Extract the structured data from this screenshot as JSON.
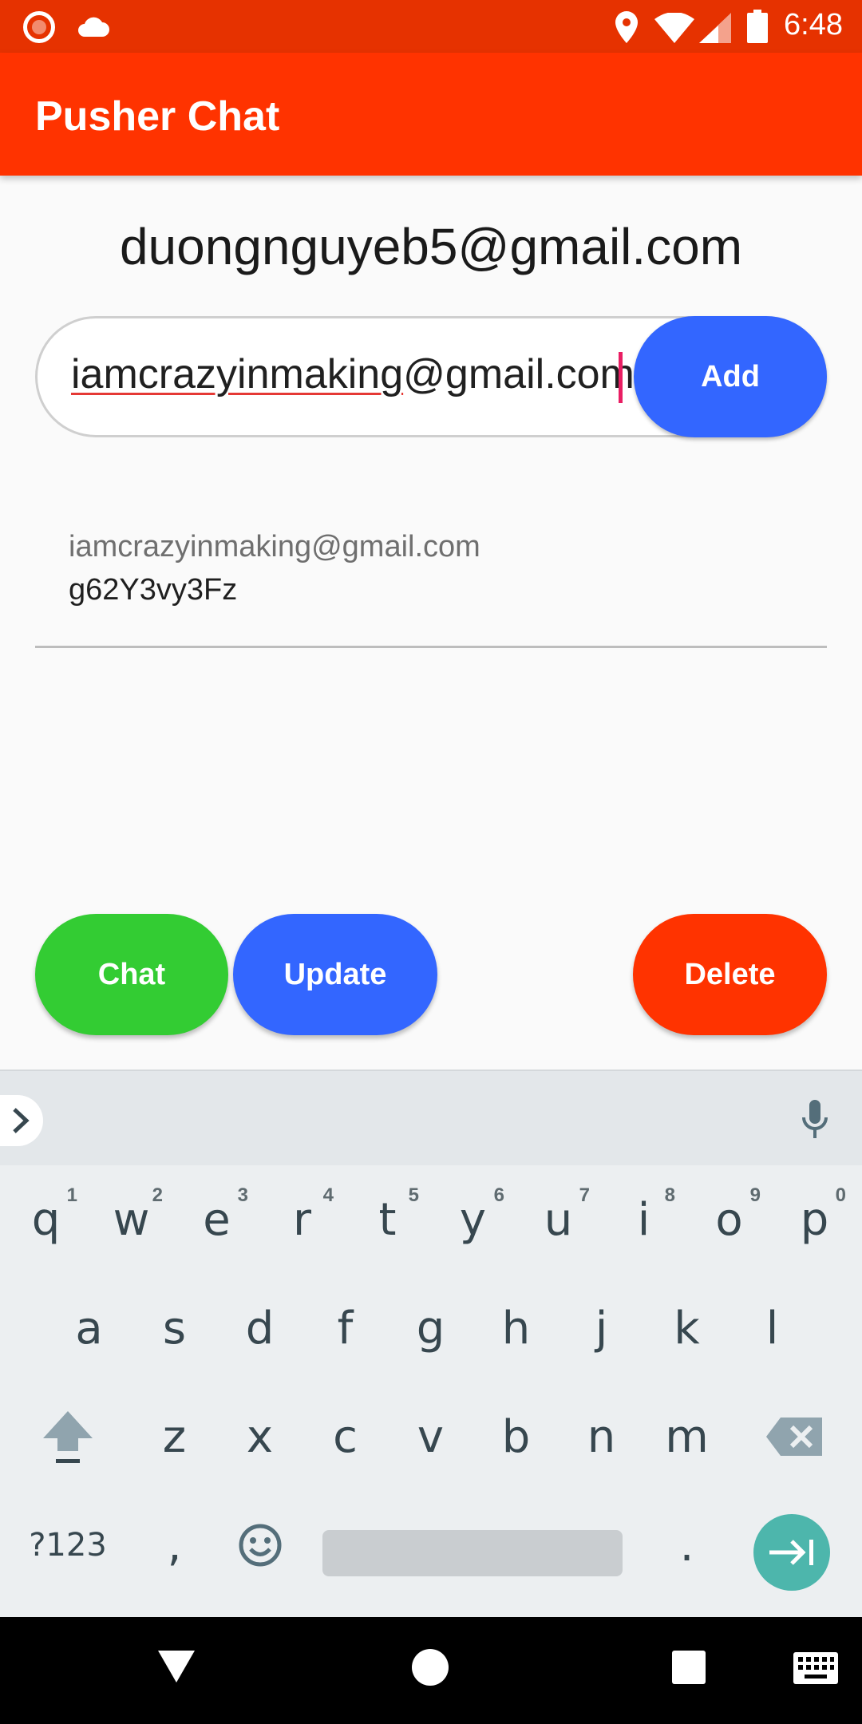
{
  "status_bar": {
    "time": "6:48",
    "icons": [
      "screen-record-icon",
      "cloud-icon",
      "location-pin-icon",
      "wifi-icon",
      "cell-signal-icon",
      "battery-icon"
    ]
  },
  "app_bar": {
    "title": "Pusher Chat"
  },
  "user": {
    "email": "duongnguyeb5@gmail.com"
  },
  "add_contact": {
    "input_value_spell": "iamcrazyinmaking",
    "input_value_rest": "@gmail.com",
    "add_label": "Add"
  },
  "contacts": [
    {
      "email": "iamcrazyinmaking@gmail.com",
      "code": "g62Y3vy3Fz"
    }
  ],
  "actions": {
    "chat_label": "Chat",
    "update_label": "Update",
    "delete_label": "Delete"
  },
  "keyboard": {
    "row1": [
      {
        "key": "q",
        "hint": "1"
      },
      {
        "key": "w",
        "hint": "2"
      },
      {
        "key": "e",
        "hint": "3"
      },
      {
        "key": "r",
        "hint": "4"
      },
      {
        "key": "t",
        "hint": "5"
      },
      {
        "key": "y",
        "hint": "6"
      },
      {
        "key": "u",
        "hint": "7"
      },
      {
        "key": "i",
        "hint": "8"
      },
      {
        "key": "o",
        "hint": "9"
      },
      {
        "key": "p",
        "hint": "0"
      }
    ],
    "row2": [
      "a",
      "s",
      "d",
      "f",
      "g",
      "h",
      "j",
      "k",
      "l"
    ],
    "row3": [
      "z",
      "x",
      "c",
      "v",
      "b",
      "n",
      "m"
    ],
    "symbols_label": "?123",
    "comma": ",",
    "period": "."
  },
  "colors": {
    "status_bar": "#e63200",
    "app_bar": "#ff3300",
    "add_button": "#3366ff",
    "chat_button": "#33cc33",
    "update_button": "#3366ff",
    "delete_button": "#ff3300",
    "enter_key": "#4db6ac"
  }
}
